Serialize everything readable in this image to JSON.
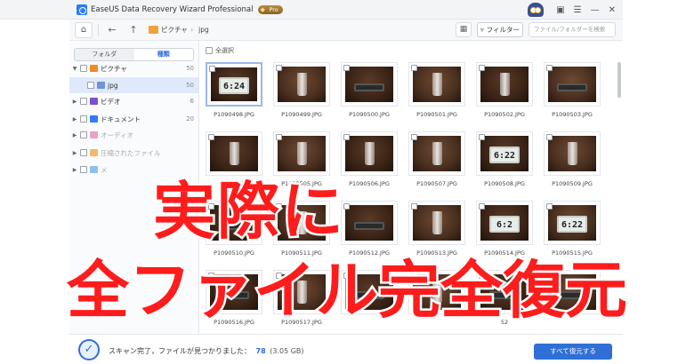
{
  "app": {
    "title": "EaseUS Data Recovery Wizard Professional",
    "badge": "Pro"
  },
  "toolbar": {
    "breadcrumb": [
      "ピクチャ",
      "jpg"
    ],
    "filter_label": "フィルター",
    "search_placeholder": "ファイル/フォルダーを検索"
  },
  "sidebar": {
    "tabs": [
      {
        "label": "フォルダ",
        "active": false
      },
      {
        "label": "種類",
        "active": true
      }
    ],
    "items": [
      {
        "label": "ピクチャ",
        "count": "50",
        "color": "#f08a24",
        "indent": 0,
        "expanded": true,
        "dim": false
      },
      {
        "label": "jpg",
        "count": "50",
        "color": "#6e93d6",
        "indent": 1,
        "selected": true,
        "dim": false
      },
      {
        "label": "ビデオ",
        "count": "6",
        "color": "#7b4fd6",
        "indent": 0,
        "dim": false
      },
      {
        "label": "ドキュメント",
        "count": "20",
        "color": "#2f7cf6",
        "indent": 0,
        "dim": false
      },
      {
        "label": "オーディオ",
        "count": "",
        "color": "#e8a4c4",
        "indent": 0,
        "dim": true
      },
      {
        "label": "圧縮されたファイル",
        "count": "",
        "color": "#f4b86a",
        "indent": 0,
        "dim": true
      },
      {
        "label": "メ",
        "count": "",
        "color": "#8cc0f0",
        "indent": 0,
        "dim": true
      }
    ]
  },
  "content": {
    "select_all_label": "全選択",
    "thumbnails": [
      {
        "name": "P1090498.JPG",
        "kind": "clock",
        "text": "6:24"
      },
      {
        "name": "P1090499.JPG",
        "kind": "glass"
      },
      {
        "name": "P1090500.JPG",
        "kind": "dark"
      },
      {
        "name": "P1090501.JPG",
        "kind": "glass"
      },
      {
        "name": "P1090502.JPG",
        "kind": "glass"
      },
      {
        "name": "P1090503.JPG",
        "kind": "dark"
      },
      {
        "name": "P10905",
        "kind": "glass"
      },
      {
        "name": "P1090505.JPG",
        "kind": "glass"
      },
      {
        "name": "P1090506.JPG",
        "kind": "glass"
      },
      {
        "name": "P1090507.JPG",
        "kind": "glass"
      },
      {
        "name": "P1090508.JPG",
        "kind": "clock",
        "text": "6:22"
      },
      {
        "name": "P1090509.JPG",
        "kind": "glass"
      },
      {
        "name": "P1090510.JPG",
        "kind": "dark"
      },
      {
        "name": "P1090511.JPG",
        "kind": "glass"
      },
      {
        "name": "P1090512.JPG",
        "kind": "dark"
      },
      {
        "name": "P1090513.JPG",
        "kind": "glass"
      },
      {
        "name": "P1090514.JPG",
        "kind": "clock",
        "text": "6:2"
      },
      {
        "name": "P1090515.JPG",
        "kind": "clock",
        "text": "6:22"
      },
      {
        "name": "P1090516.JPG",
        "kind": "dark"
      },
      {
        "name": "P1090517.JPG",
        "kind": "glass"
      },
      {
        "name": "",
        "kind": "dark"
      },
      {
        "name": "",
        "kind": "glass"
      },
      {
        "name": "52",
        "kind": "dark"
      },
      {
        "name": "",
        "kind": "dark"
      }
    ]
  },
  "status": {
    "text": "スキャン完了，ファイルが見つかりました：",
    "count": "78",
    "size": "(3.05 GB)",
    "recover_label": "すべて復元する"
  },
  "overlay": {
    "line1": "実際に",
    "line2": "全ファイル完全復元"
  }
}
